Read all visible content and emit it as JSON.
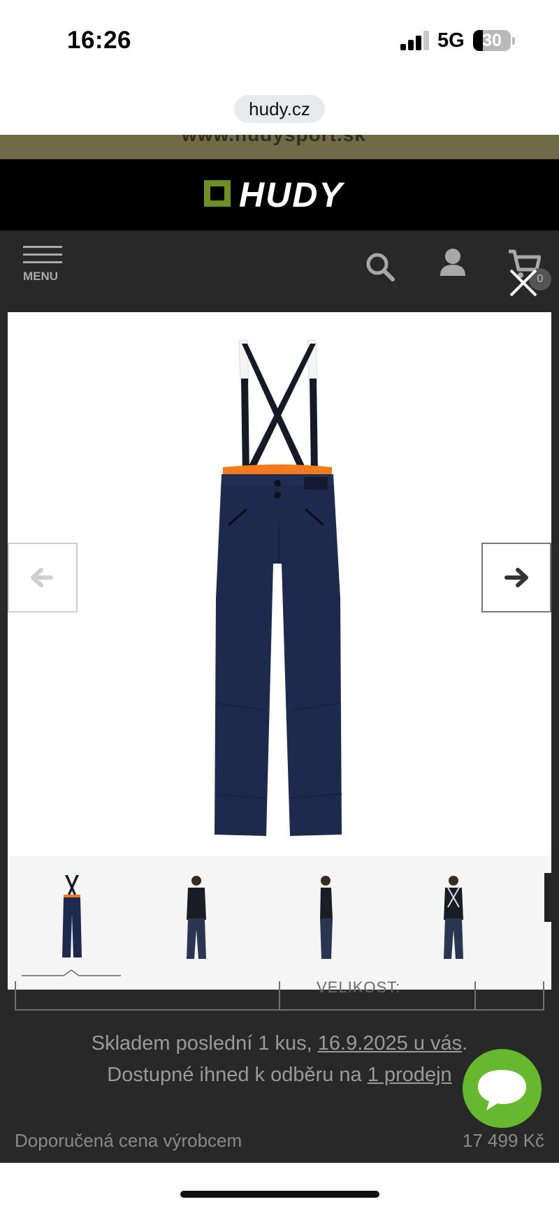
{
  "status_bar": {
    "time": "16:26",
    "network": "5G",
    "battery": "30"
  },
  "browser": {
    "url": "hudy.cz"
  },
  "site": {
    "promo": "www.hudysport.sk",
    "logo": "HUDY",
    "menu_label": "MENU",
    "cart_count": "0"
  },
  "product": {
    "size_header": "VELIKOST:",
    "stock_prefix": "Skladem poslední 1 kus, ",
    "stock_date_link": "16.9.2025 u vás",
    "stock_suffix": ".",
    "pickup_prefix": "Dostupné ihned k odběru na ",
    "pickup_link": "1 prodejn",
    "price_label": "Doporučená cena výrobcem",
    "price_value": "17 499 Kč"
  },
  "colors": {
    "brand_green": "#6d8f28",
    "chat_green": "#66b82e",
    "pants_navy": "#1d2a4d",
    "lining_orange": "#f07a1c"
  },
  "icons": [
    "menu-icon",
    "search-icon",
    "user-icon",
    "cart-icon",
    "close-icon",
    "arrow-left-icon",
    "arrow-right-icon",
    "chat-icon"
  ]
}
